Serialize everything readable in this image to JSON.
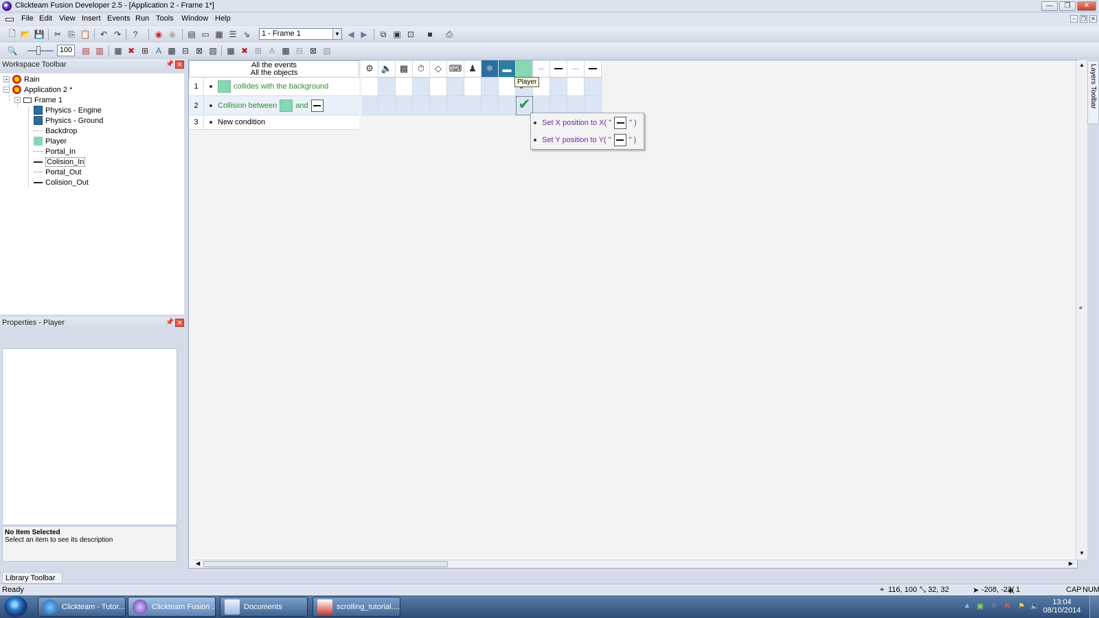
{
  "window": {
    "title": "Clickteam Fusion Developer 2.5 - [Application 2 - Frame 1*]",
    "controls": {
      "minimize": "—",
      "restore": "❐",
      "close": "✕"
    },
    "mdi_controls": {
      "minimize": "–",
      "restore": "❐",
      "close": "✕"
    }
  },
  "menu": {
    "items": [
      "File",
      "Edit",
      "View",
      "Insert",
      "Events",
      "Run",
      "Tools",
      "Window",
      "Help"
    ]
  },
  "toolbar": {
    "frame_select": "1 - Frame 1",
    "zoom_value": "100"
  },
  "workspace": {
    "title": "Workspace Toolbar",
    "tree": [
      {
        "label": "Rain",
        "icon": "rain-icon"
      },
      {
        "label": "Application 2 *",
        "icon": "rain-icon"
      },
      {
        "label": "Frame 1",
        "icon": "frame-icon"
      },
      {
        "label": "Physics - Engine",
        "icon": "physics-icon"
      },
      {
        "label": "Physics - Ground",
        "icon": "physics-icon"
      },
      {
        "label": "Backdrop",
        "icon": "backdrop-icon"
      },
      {
        "label": "Player",
        "icon": "player-icon"
      },
      {
        "label": "Portal_In",
        "icon": "dotted-line-icon"
      },
      {
        "label": "Colision_In",
        "icon": "line-icon"
      },
      {
        "label": "Portal_Out",
        "icon": "dotted-line-icon"
      },
      {
        "label": "Colision_Out",
        "icon": "line-icon"
      }
    ]
  },
  "properties": {
    "title": "Properties - Player",
    "desc_title": "No Item Selected",
    "desc_text": "Select an item to see its description"
  },
  "library": {
    "tab": "Library Toolbar"
  },
  "events": {
    "header_line1": "All the events",
    "header_line2": "All the objects",
    "rows": [
      {
        "num": "1",
        "text": "collides with the background"
      },
      {
        "num": "2",
        "text_a": "Collision between",
        "text_b": "and"
      },
      {
        "num": "3",
        "text": "New condition"
      }
    ],
    "tooltip": "Player",
    "actions": [
      {
        "prefix": "Set X position to X( \"",
        "suffix": "\" )"
      },
      {
        "prefix": "Set Y position to Y( \"",
        "suffix": "\" )"
      }
    ]
  },
  "layers": {
    "tab": "Layers Toolbar"
  },
  "status": {
    "ready": "Ready",
    "coords": "116, 100",
    "size": "32, 32",
    "mouse": "-208, -23(",
    "layer": "1",
    "cap": "CAP",
    "num": "NUM"
  },
  "taskbar": {
    "buttons": [
      "Clickteam - Tutor...",
      "Clickteam Fusion ...",
      "Documents",
      "scrolling_tutorial...."
    ],
    "time": "13:04",
    "date": "08/10/2014"
  },
  "colors": {
    "player": "#86d8b4",
    "condition_text": "#2c8f2c",
    "action_text": "#6a2a9a"
  }
}
